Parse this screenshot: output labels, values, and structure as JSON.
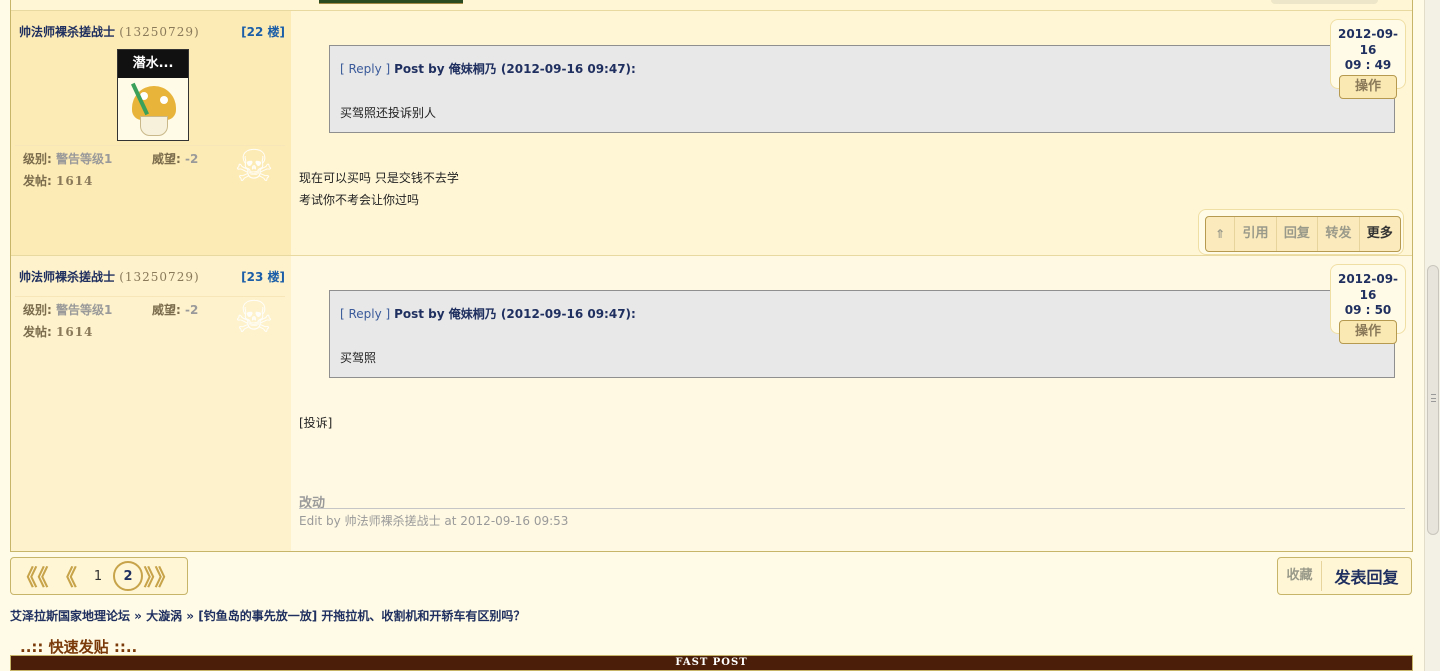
{
  "posts": [
    {
      "user_name": "帅法师裸杀搓战士",
      "user_uid": "(13250729)",
      "floor": "[22 楼]",
      "avatar_text": "潜水...",
      "level_label": "级别:",
      "level_value": "警告等级1",
      "prestige_label": "威望:",
      "prestige_value": "-2",
      "posts_label": "发帖:",
      "posts_value": "1614",
      "quote_reply": "[ Reply ]",
      "quote_by": "Post by 俺妹桐乃 (2012-09-16 09:47):",
      "quote_text": "买驾照还投诉别人",
      "time_date": "2012-09-16",
      "time_clock": "09 : 49",
      "op_label": "操作",
      "body_lines": [
        "现在可以买吗 只是交钱不去学",
        "考试你不考会让你过吗"
      ],
      "actions": [
        "⇑",
        "引用",
        "回复",
        "转发",
        "更多"
      ]
    },
    {
      "user_name": "帅法师裸杀搓战士",
      "user_uid": "(13250729)",
      "floor": "[23 楼]",
      "level_label": "级别:",
      "level_value": "警告等级1",
      "prestige_label": "威望:",
      "prestige_value": "-2",
      "posts_label": "发帖:",
      "posts_value": "1614",
      "quote_reply": "[ Reply ]",
      "quote_by": "Post by 俺妹桐乃 (2012-09-16 09:47):",
      "quote_text": "买驾照",
      "time_date": "2012-09-16",
      "time_clock": "09 : 50",
      "op_label": "操作",
      "body_lines": [
        "[投诉]"
      ],
      "edit_title": "改动",
      "edit_line": "Edit by 帅法师裸杀搓战士 at 2012-09-16 09:53"
    }
  ],
  "pager": {
    "first": "《《",
    "prev": "《",
    "page1": "1",
    "page2": "2",
    "next": "》》"
  },
  "reply_box": {
    "favorite": "收藏",
    "post_reply": "发表回复"
  },
  "breadcrumb": "艾泽拉斯国家地理论坛 » 大漩涡 » [钓鱼岛的事先放一放] 开拖拉机、收割机和开轿车有区别吗？",
  "quick_post_title": "..:: 快速发贴 ::..",
  "fast_post_bar": "FAST POST",
  "icons": {
    "skull": "skull-icon",
    "up_arrow": "up-arrow-icon"
  },
  "colors": {
    "name": "#1f2f5f",
    "floor": "#1c5fa8",
    "border": "#c7b56a",
    "fast_post": "#4a1e08"
  }
}
